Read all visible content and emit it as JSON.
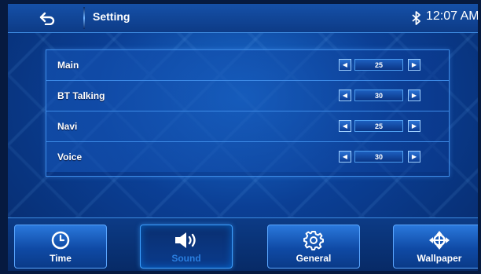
{
  "header": {
    "title": "Setting",
    "time": "12:07 AM",
    "back_icon": "back-arrow-icon",
    "bluetooth_icon": "bluetooth-icon"
  },
  "volume_rows": [
    {
      "label": "Main",
      "value": "25"
    },
    {
      "label": "BT Talking",
      "value": "30"
    },
    {
      "label": "Navi",
      "value": "25"
    },
    {
      "label": "Voice",
      "value": "30"
    }
  ],
  "tabs": [
    {
      "label": "Time",
      "icon": "clock-icon",
      "active": false
    },
    {
      "label": "Sound",
      "icon": "speaker-icon",
      "active": true
    },
    {
      "label": "General",
      "icon": "gear-icon",
      "active": false
    },
    {
      "label": "Wallpaper",
      "icon": "wallpaper-icon",
      "active": false
    }
  ],
  "colors": {
    "background": "#0b3f95",
    "accent": "#3c8ae6",
    "active_tab_label": "#2a7fe0"
  }
}
